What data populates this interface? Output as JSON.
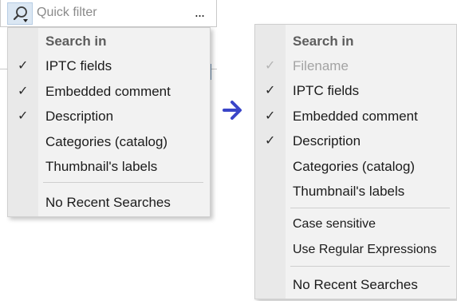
{
  "toolbar": {
    "search_icon": "magnifier-dropdown-icon",
    "placeholder": "Quick filter",
    "more_label": "..."
  },
  "colors": {
    "accent": "#3a45c8",
    "menu_bg": "#f2f2f2",
    "gutter_bg": "#e9e9e9"
  },
  "left_menu": {
    "header": "Search in",
    "items": [
      {
        "label": "IPTC fields",
        "check": "✓",
        "checked": true
      },
      {
        "label": "Embedded comment",
        "check": "✓",
        "checked": true
      },
      {
        "label": "Description",
        "check": "✓",
        "checked": true
      },
      {
        "label": "Categories (catalog)",
        "check": "",
        "checked": false
      },
      {
        "label": "Thumbnail's labels",
        "check": "",
        "checked": false
      }
    ],
    "recent": "No Recent Searches"
  },
  "right_menu": {
    "header": "Search in",
    "items": [
      {
        "label": "Filename",
        "check": "✓",
        "checked": true,
        "disabled": true
      },
      {
        "label": "IPTC fields",
        "check": "✓",
        "checked": true
      },
      {
        "label": "Embedded comment",
        "check": "✓",
        "checked": true
      },
      {
        "label": "Description",
        "check": "✓",
        "checked": true
      },
      {
        "label": "Categories (catalog)",
        "check": "",
        "checked": false
      },
      {
        "label": "Thumbnail's labels",
        "check": "",
        "checked": false
      }
    ],
    "options": [
      {
        "label": "Case sensitive"
      },
      {
        "label": "Use Regular Expressions"
      }
    ],
    "recent": "No Recent Searches"
  }
}
